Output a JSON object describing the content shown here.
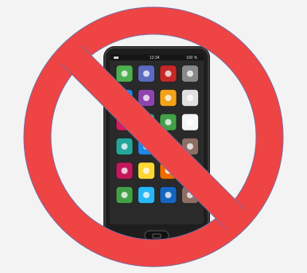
{
  "status_bar": {
    "time": "12:34",
    "battery": "100 %"
  },
  "apps": [
    {
      "name": "messages-app-icon",
      "color": "#4caf50"
    },
    {
      "name": "photos-app-icon",
      "color": "#5c6bc0"
    },
    {
      "name": "calendar-app-icon",
      "color": "#c62828"
    },
    {
      "name": "settings-app-icon",
      "color": "#8a8a8a"
    },
    {
      "name": "phone-settings-app-icon",
      "color": "#1e88e5"
    },
    {
      "name": "contacts-app-icon",
      "color": "#8e44ad"
    },
    {
      "name": "camera-app-icon",
      "color": "#f4a21a"
    },
    {
      "name": "clock-app-icon",
      "color": "#e0e0e0"
    },
    {
      "name": "music-app-icon",
      "color": "#d81b60"
    },
    {
      "name": "chart-app-icon",
      "color": "#26a69a"
    },
    {
      "name": "train-app-icon",
      "color": "#43a047"
    },
    {
      "name": "health-app-icon",
      "color": "#f5f5f5"
    },
    {
      "name": "maps-app-icon",
      "color": "#26a69a"
    },
    {
      "name": "flights-app-icon",
      "color": "#1e88e5"
    },
    {
      "name": "notes-app-icon",
      "color": "#fbc02d"
    },
    {
      "name": "compass-app-icon",
      "color": "#8d6e63"
    },
    {
      "name": "games-app-icon",
      "color": "#c2185b"
    },
    {
      "name": "shopping-app-icon",
      "color": "#fdd835"
    },
    {
      "name": "store-app-icon",
      "color": "#ef6c00"
    },
    {
      "name": "wallet-app-icon",
      "color": "#6d4c41"
    },
    {
      "name": "call-app-icon",
      "color": "#43a047"
    },
    {
      "name": "browser-app-icon",
      "color": "#29b6f6"
    },
    {
      "name": "mail-app-icon",
      "color": "#1565c0"
    },
    {
      "name": "voice-recorder-app-icon",
      "color": "#8d6e63"
    }
  ],
  "colors": {
    "prohibition_red": "#ef4444",
    "prohibition_outline": "#7b6a9e",
    "phone_body": "#1e1e1e",
    "phone_screen": "#2a2a2a"
  }
}
